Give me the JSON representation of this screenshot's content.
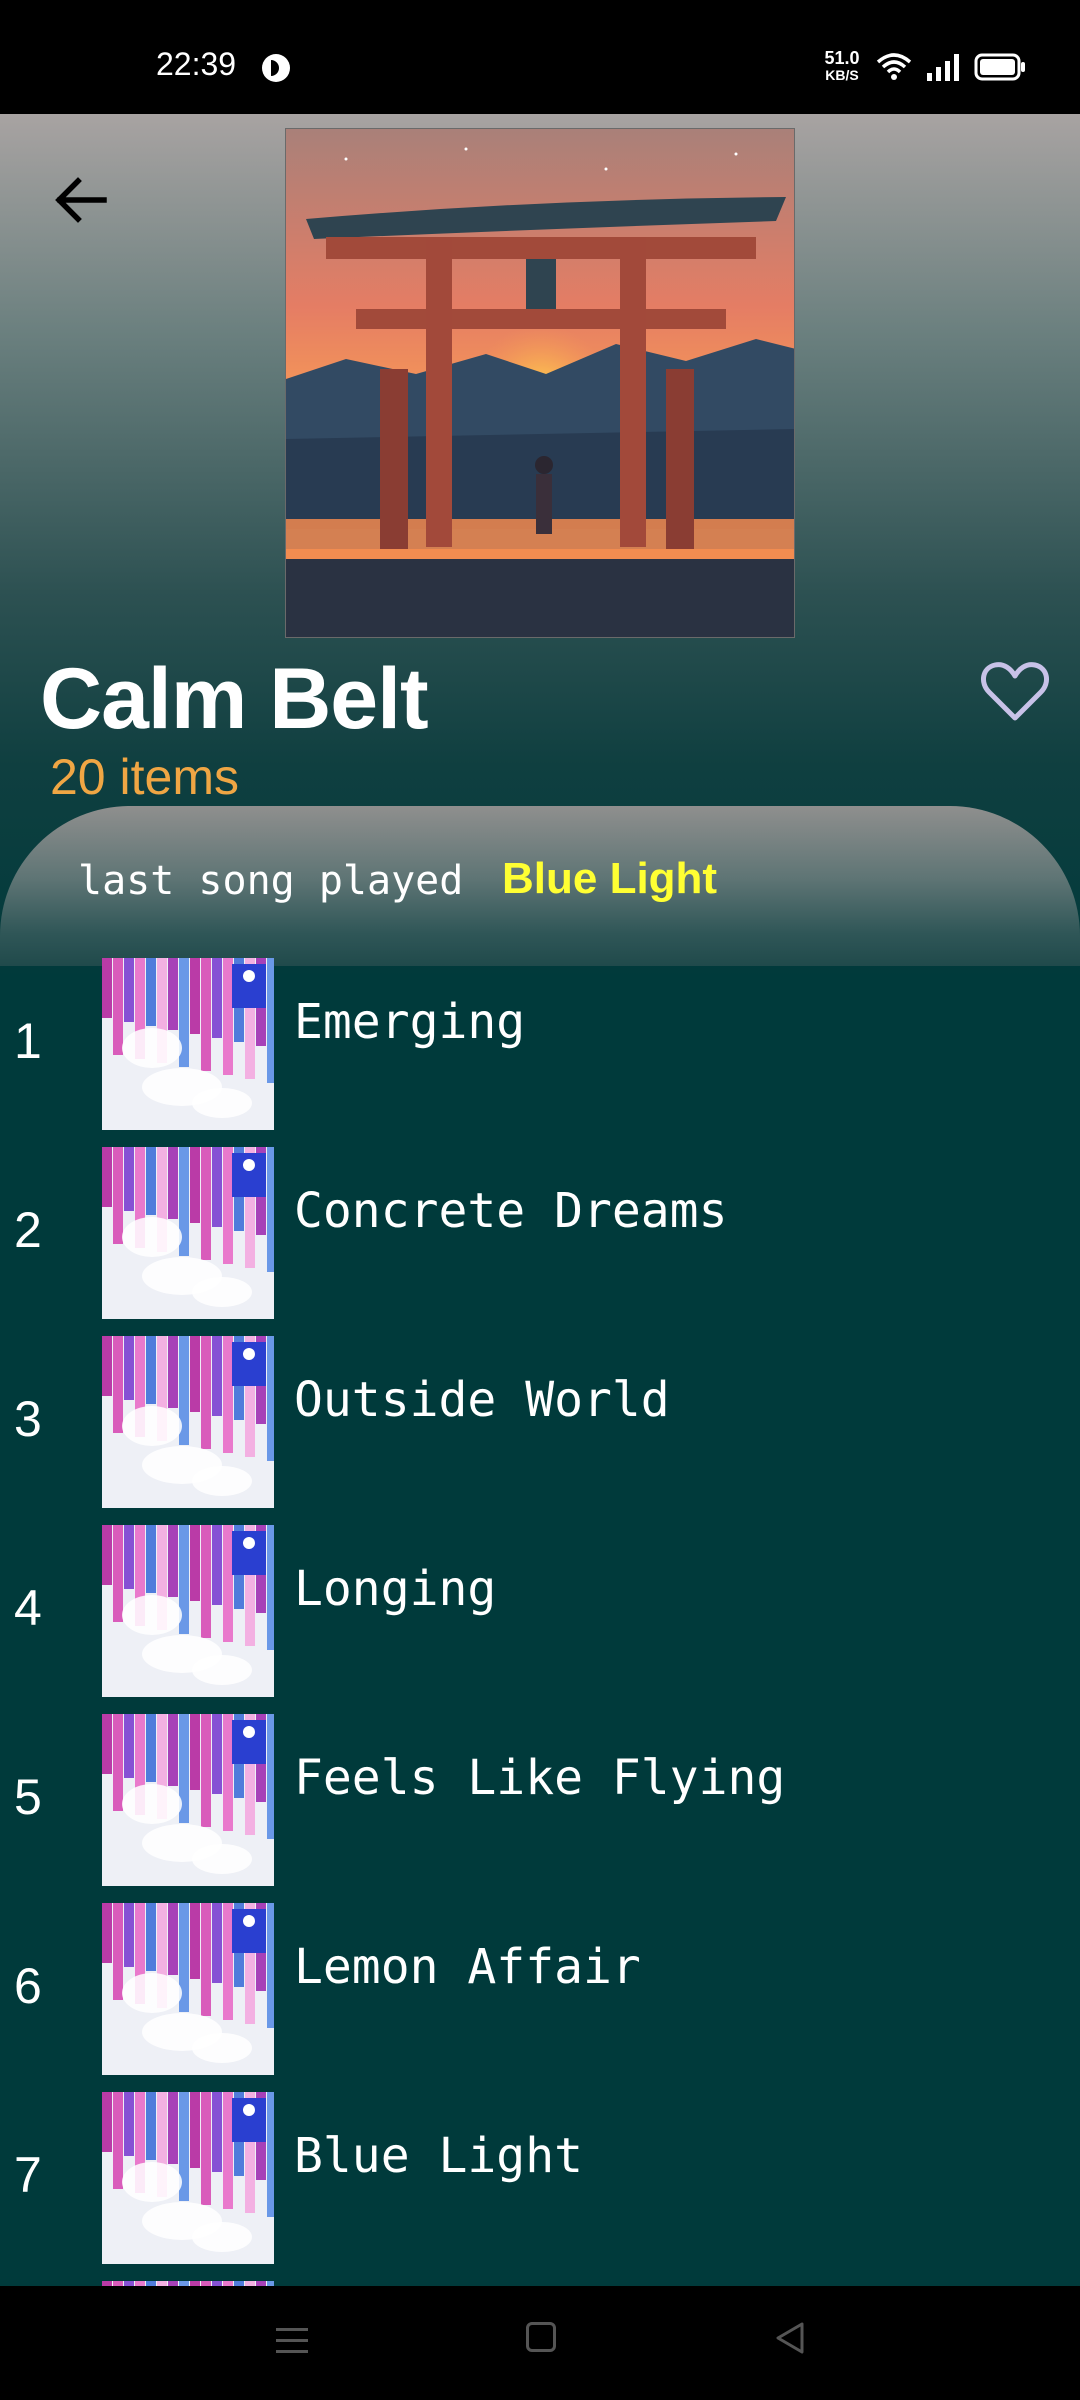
{
  "status_bar": {
    "time": "22:39",
    "net_speed_value": "51.0",
    "net_speed_unit": "KB/S"
  },
  "playlist": {
    "title": "Calm Belt",
    "item_count": "20 items"
  },
  "last_played": {
    "label": "last song played",
    "song": "Blue Light"
  },
  "songs": [
    {
      "number": "1",
      "title": "Emerging"
    },
    {
      "number": "2",
      "title": "Concrete Dreams"
    },
    {
      "number": "3",
      "title": "Outside World"
    },
    {
      "number": "4",
      "title": "Longing"
    },
    {
      "number": "5",
      "title": "Feels Like Flying"
    },
    {
      "number": "6",
      "title": "Lemon Affair"
    },
    {
      "number": "7",
      "title": "Blue Light"
    }
  ],
  "icons": {
    "back": "arrow-left-icon",
    "favorite": "heart-outline-icon",
    "nav_menu": "menu-icon",
    "nav_home": "square-icon",
    "nav_back": "triangle-back-icon"
  },
  "colors": {
    "item_count": "#f0a644",
    "last_played_song": "#ffff33",
    "list_background": "#003a3b",
    "heart": "#c8c2e8"
  }
}
